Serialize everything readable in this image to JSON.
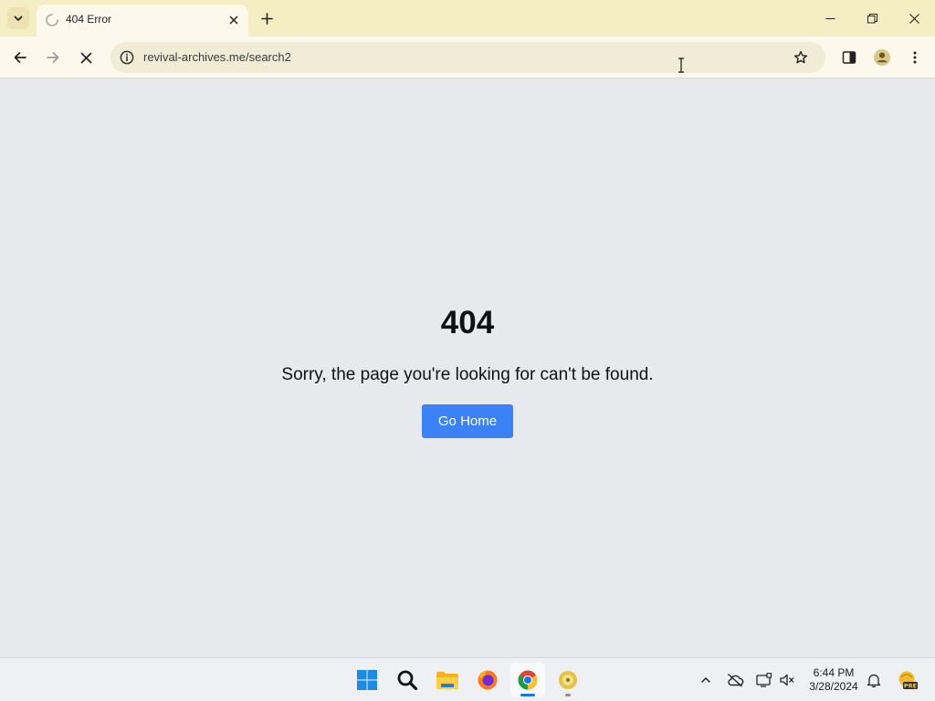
{
  "browser": {
    "tab": {
      "title": "404 Error"
    },
    "omnibox": {
      "url": "revival-archives.me/search2"
    }
  },
  "page": {
    "error_code": "404",
    "message": "Sorry, the page you're looking for can't be found.",
    "home_button_label": "Go Home",
    "button_color": "#3b82f6",
    "background_color": "#e8e9ed"
  },
  "taskbar": {
    "apps": [
      {
        "name": "start",
        "icon": "windows-logo-icon"
      },
      {
        "name": "search",
        "icon": "search-icon"
      },
      {
        "name": "file-explorer",
        "icon": "folder-icon"
      },
      {
        "name": "firefox",
        "icon": "firefox-icon"
      },
      {
        "name": "chrome",
        "icon": "chrome-icon",
        "active": true
      },
      {
        "name": "app",
        "icon": "cd-icon"
      }
    ],
    "clock": {
      "time": "6:44 PM",
      "date": "3/28/2024"
    },
    "tray": [
      "chevron-up-icon",
      "cloud-offline-icon",
      "display-icon",
      "speaker-mute-icon",
      "bell-icon",
      "copilot-pre-icon"
    ]
  }
}
